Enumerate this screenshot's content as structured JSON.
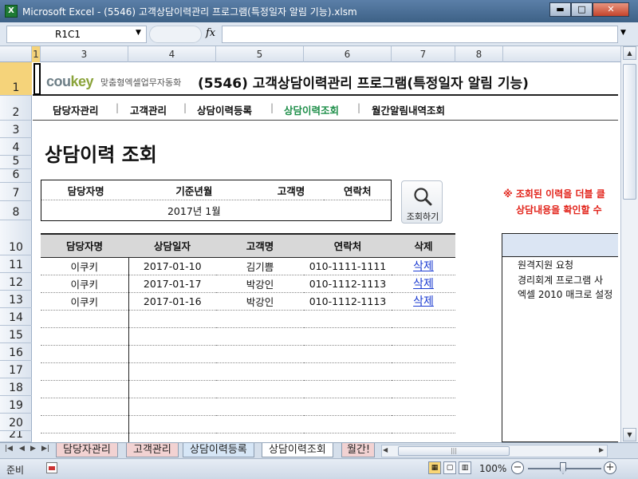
{
  "window": {
    "title": "Microsoft Excel - (5546) 고객상담이력관리 프로그램(특정일자 알림 기능).xlsm",
    "app_icon": "X",
    "min": "▬",
    "max": "□",
    "close": "✕"
  },
  "formula_bar": {
    "name_box": "R1C1",
    "fx": "fx",
    "value": ""
  },
  "columns": [
    "1",
    "3",
    "4",
    "5",
    "6",
    "7",
    "8"
  ],
  "rows": [
    "1",
    "2",
    "3",
    "4",
    "5",
    "6",
    "7",
    "8",
    "10",
    "11",
    "12",
    "13",
    "14",
    "15",
    "16",
    "17",
    "18",
    "19",
    "20",
    "21"
  ],
  "sheet": {
    "logo": "coukey",
    "logo_sub": "맞춤형엑셀업무자동화",
    "title": "(5546) 고객상담이력관리 프로그램(특정일자 알림 기능)",
    "nav": [
      "담당자관리",
      "고객관리",
      "상담이력등록",
      "상담이력조회",
      "월간알림내역조회"
    ],
    "nav_active": 3,
    "heading": "상담이력 조회",
    "filter": {
      "headers": [
        "담당자명",
        "기준년월",
        "고객명",
        "연락처"
      ],
      "values": [
        "",
        "2017년 1월",
        "",
        ""
      ]
    },
    "search_button": "조회하기",
    "notice": [
      "※ 조회된 이력을 더블 클",
      "상담내용을 확인할 수"
    ],
    "result": {
      "headers": [
        "담당자명",
        "상담일자",
        "고객명",
        "연락처",
        "삭제"
      ],
      "rows": [
        [
          "이쿠키",
          "2017-01-10",
          "김기쁨",
          "010-1111-1111",
          "삭제"
        ],
        [
          "이쿠키",
          "2017-01-17",
          "박강인",
          "010-1112-1113",
          "삭제"
        ],
        [
          "이쿠키",
          "2017-01-16",
          "박강인",
          "010-1112-1113",
          "삭제"
        ]
      ],
      "empty_rows": 8
    },
    "detail_lines": [
      "원격지원 요청",
      "경리회계 프로그램 사",
      "엑셀 2010 매크로 설정"
    ]
  },
  "tabs": [
    "담당자관리",
    "고객관리",
    "상담이력등록",
    "상담이력조회",
    "월간!"
  ],
  "tab_active": 3,
  "status": {
    "ready": "준비",
    "zoom": "100%",
    "zoom_percent": 100
  }
}
